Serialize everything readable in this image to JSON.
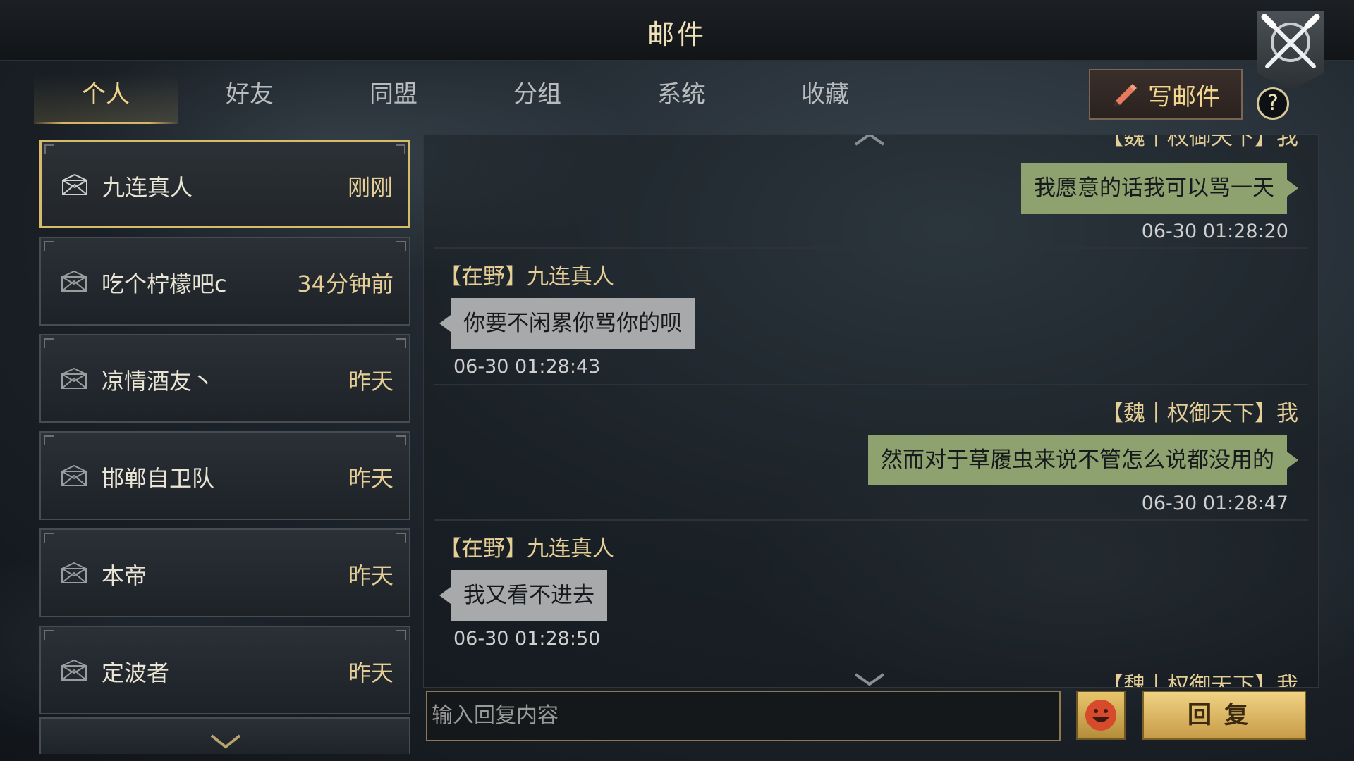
{
  "window": {
    "title": "邮件"
  },
  "tabs": [
    {
      "label": "个人",
      "active": true
    },
    {
      "label": "好友",
      "active": false
    },
    {
      "label": "同盟",
      "active": false
    },
    {
      "label": "分组",
      "active": false
    },
    {
      "label": "系统",
      "active": false
    },
    {
      "label": "收藏",
      "active": false
    }
  ],
  "toolbar": {
    "write_label": "写邮件",
    "help_label": "?"
  },
  "mail_list": [
    {
      "name": "九连真人",
      "time": "刚刚",
      "active": true
    },
    {
      "name": "吃个柠檬吧c",
      "time": "34分钟前",
      "active": false
    },
    {
      "name": "凉情酒友丶",
      "time": "昨天",
      "active": false
    },
    {
      "name": "邯郸自卫队",
      "time": "昨天",
      "active": false
    },
    {
      "name": "本帝",
      "time": "昨天",
      "active": false
    },
    {
      "name": "定波者",
      "time": "昨天",
      "active": false
    }
  ],
  "conversation": [
    {
      "side": "right",
      "sender": "【魏丨权御天下】我",
      "text": "我愿意的话我可以骂一天",
      "time": "06-30 01:28:20"
    },
    {
      "side": "left",
      "sender": "【在野】九连真人",
      "text": "你要不闲累你骂你的呗",
      "time": "06-30 01:28:43"
    },
    {
      "side": "right",
      "sender": "【魏丨权御天下】我",
      "text": "然而对于草履虫来说不管怎么说都没用的",
      "time": "06-30 01:28:47"
    },
    {
      "side": "left",
      "sender": "【在野】九连真人",
      "text": "我又看不进去",
      "time": "06-30 01:28:50"
    },
    {
      "side": "right",
      "sender": "【魏丨权御天下】我"
    }
  ],
  "reply": {
    "placeholder": "输入回复内容",
    "button_label": "回复"
  },
  "colors": {
    "accent_gold": "#e6cf96",
    "my_bubble": "#8ea26f",
    "their_bubble": "#a7a9ab"
  }
}
